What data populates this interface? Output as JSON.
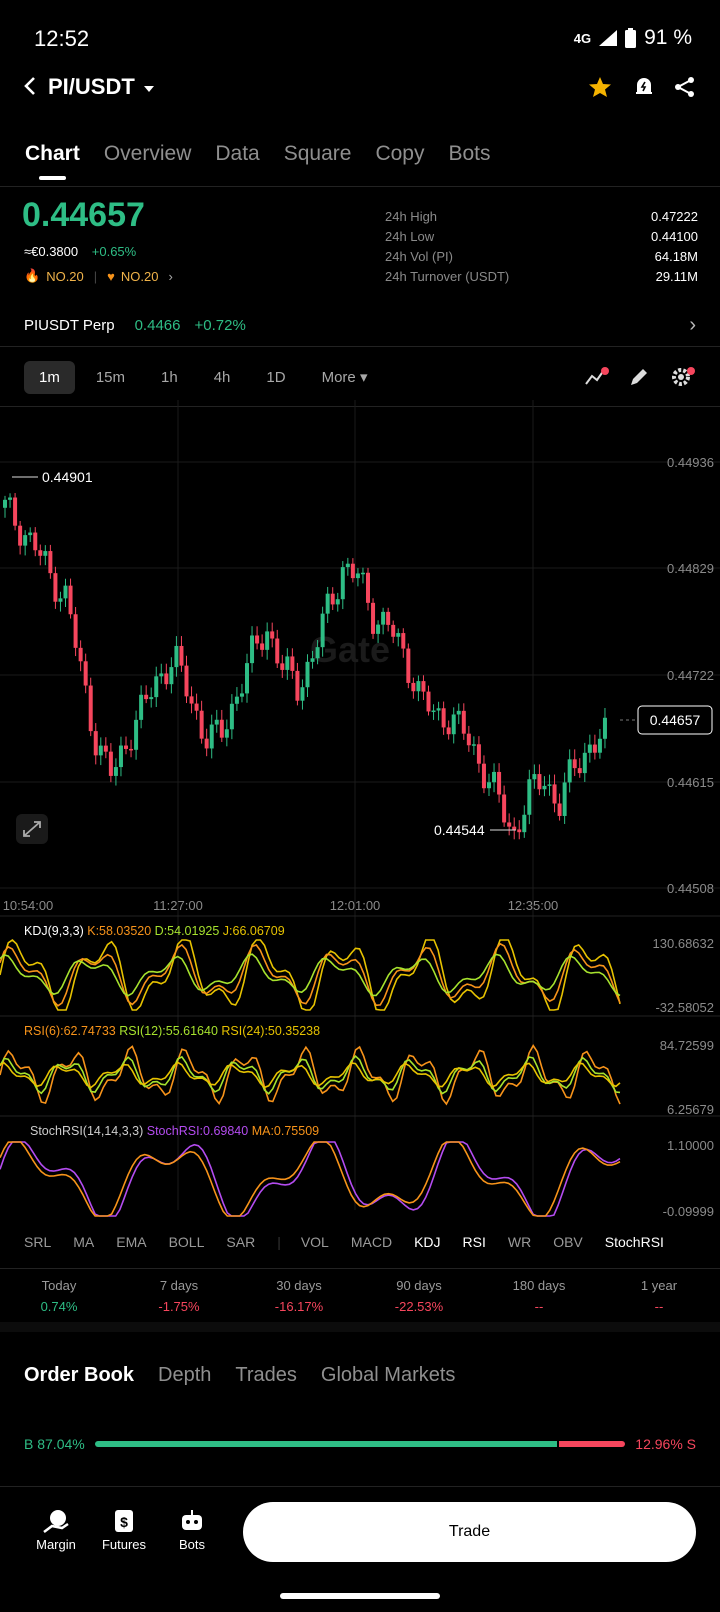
{
  "status_bar": {
    "time": "12:52",
    "network": "4G",
    "battery": "91 %"
  },
  "header": {
    "pair": "PI/USDT"
  },
  "main_tabs": [
    "Chart",
    "Overview",
    "Data",
    "Square",
    "Copy",
    "Bots"
  ],
  "price": {
    "last": "0.44657",
    "fiat": "≈€0.3800",
    "change": "+0.65%",
    "rank1": "NO.20",
    "rank2": "NO.20"
  },
  "stats": [
    {
      "label": "24h High",
      "value": "0.47222"
    },
    {
      "label": "24h Low",
      "value": "0.44100"
    },
    {
      "label": "24h Vol (PI)",
      "value": "64.18M"
    },
    {
      "label": "24h Turnover (USDT)",
      "value": "29.11M"
    }
  ],
  "perp": {
    "name": "PIUSDT Perp",
    "price": "0.4466",
    "change": "+0.72%"
  },
  "timeframes": [
    "1m",
    "15m",
    "1h",
    "4h",
    "1D",
    "More"
  ],
  "chart_data": {
    "type": "candlestick",
    "y_ticks": [
      "0.44936",
      "0.44829",
      "0.44722",
      "0.44615",
      "0.44508"
    ],
    "x_ticks": [
      "10:54:00",
      "11:27:00",
      "12:01:00",
      "12:35:00"
    ],
    "high_marker": "0.44901",
    "low_marker": "0.44544",
    "current_price_tag": "0.44657",
    "ylim": [
      0.44508,
      0.44936
    ],
    "candle_colors": {
      "up": "#2ebd85",
      "down": "#f6465d"
    },
    "watermark": "Gate"
  },
  "indicators": {
    "kdj": {
      "label": "KDJ(9,3,3)",
      "k": "K:58.03520",
      "d": "D:54.01925",
      "j": "J:66.06709",
      "max": "130.68632",
      "min": "-32.58052"
    },
    "rsi": {
      "r6": "RSI(6):62.74733",
      "r12": "RSI(12):55.61640",
      "r24": "RSI(24):50.35238",
      "max": "84.72599",
      "min": "6.25679"
    },
    "stochrsi": {
      "label": "StochRSI(14,14,3,3)",
      "value": "StochRSI:0.69840",
      "ma": "MA:0.75509",
      "max": "1.10000",
      "min": "-0.09999"
    }
  },
  "indicator_tabs_left": [
    "SRL",
    "MA",
    "EMA",
    "BOLL",
    "SAR"
  ],
  "indicator_tabs_right": [
    "VOL",
    "MACD",
    "KDJ",
    "RSI",
    "WR",
    "OBV",
    "StochRSI"
  ],
  "performance": [
    {
      "label": "Today",
      "value": "0.74%",
      "color": "green"
    },
    {
      "label": "7 days",
      "value": "-1.75%",
      "color": "red"
    },
    {
      "label": "30 days",
      "value": "-16.17%",
      "color": "red"
    },
    {
      "label": "90 days",
      "value": "-22.53%",
      "color": "red"
    },
    {
      "label": "180 days",
      "value": "--",
      "color": "red"
    },
    {
      "label": "1 year",
      "value": "--",
      "color": "red"
    }
  ],
  "order_book_tabs": [
    "Order Book",
    "Depth",
    "Trades",
    "Global Markets"
  ],
  "order_book_ratio": {
    "buy": "B 87.04%",
    "sell": "12.96% S",
    "buy_fraction": 0.8704
  },
  "bottom_nav": [
    "Margin",
    "Futures",
    "Bots"
  ],
  "trade_button": "Trade"
}
